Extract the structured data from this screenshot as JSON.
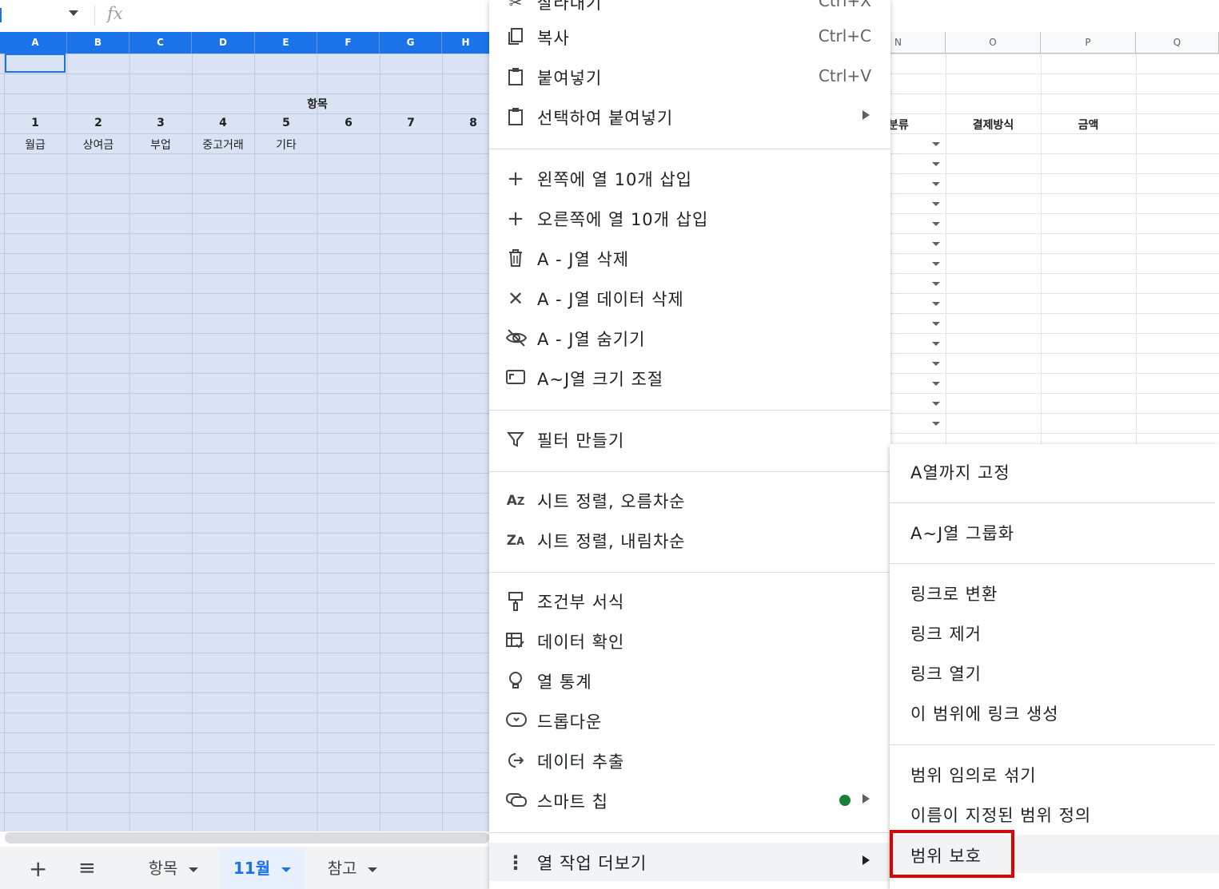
{
  "formula_bar": {
    "fx_label": "fx"
  },
  "columns_selected": [
    "A",
    "B",
    "C",
    "D",
    "E",
    "F",
    "G",
    "H"
  ],
  "columns_right": [
    "N",
    "O",
    "P",
    "Q"
  ],
  "sheet": {
    "group_header": "항목",
    "row_numbers": [
      "1",
      "2",
      "3",
      "4",
      "5",
      "6",
      "7",
      "8"
    ],
    "row_labels": [
      "월급",
      "상여금",
      "부업",
      "중고거래",
      "기타"
    ],
    "right_headers": [
      "분류",
      "결제방식",
      "금액"
    ]
  },
  "sheet_tabs": {
    "add": "+",
    "list": "≡",
    "tabs": [
      "항목",
      "11월",
      "참고"
    ],
    "active": "11월"
  },
  "context_menu": {
    "cut": {
      "label": "잘라내기",
      "shortcut": "Ctrl+X"
    },
    "copy": {
      "label": "복사",
      "shortcut": "Ctrl+C"
    },
    "paste": {
      "label": "붙여넣기",
      "shortcut": "Ctrl+V"
    },
    "paste_special": {
      "label": "선택하여 붙여넣기"
    },
    "insert_left": {
      "label": "왼쪽에 열 10개 삽입"
    },
    "insert_right": {
      "label": "오른쪽에 열 10개 삽입"
    },
    "delete_cols": {
      "label": "A - J열 삭제"
    },
    "clear_cols": {
      "label": "A - J열 데이터 삭제"
    },
    "hide_cols": {
      "label": "A - J열 숨기기"
    },
    "resize_cols": {
      "label": "A~J열 크기 조절"
    },
    "create_filter": {
      "label": "필터 만들기"
    },
    "sort_asc": {
      "label": "시트 정렬, 오름차순"
    },
    "sort_desc": {
      "label": "시트 정렬, 내림차순"
    },
    "conditional_format": {
      "label": "조건부 서식"
    },
    "data_validation": {
      "label": "데이터 확인"
    },
    "column_stats": {
      "label": "열 통계"
    },
    "dropdown": {
      "label": "드롭다운"
    },
    "data_extract": {
      "label": "데이터 추출"
    },
    "smart_chips": {
      "label": "스마트 칩"
    },
    "more_actions": {
      "label": "열 작업 더보기"
    }
  },
  "submenu": {
    "freeze": "A열까지 고정",
    "group": "A~J열 그룹화",
    "convert_links": "링크로 변환",
    "remove_links": "링크 제거",
    "open_links": "링크 열기",
    "link_range": "이 범위에 링크 생성",
    "randomize": "범위 임의로 섞기",
    "named_range": "이름이 지정된 범위 정의",
    "protect": "범위 보호"
  },
  "colors": {
    "selection_header": "#1a73e8",
    "selection_fill": "#dae3f3",
    "highlight_box": "#e00000",
    "smart_chip_dot": "#188038"
  }
}
